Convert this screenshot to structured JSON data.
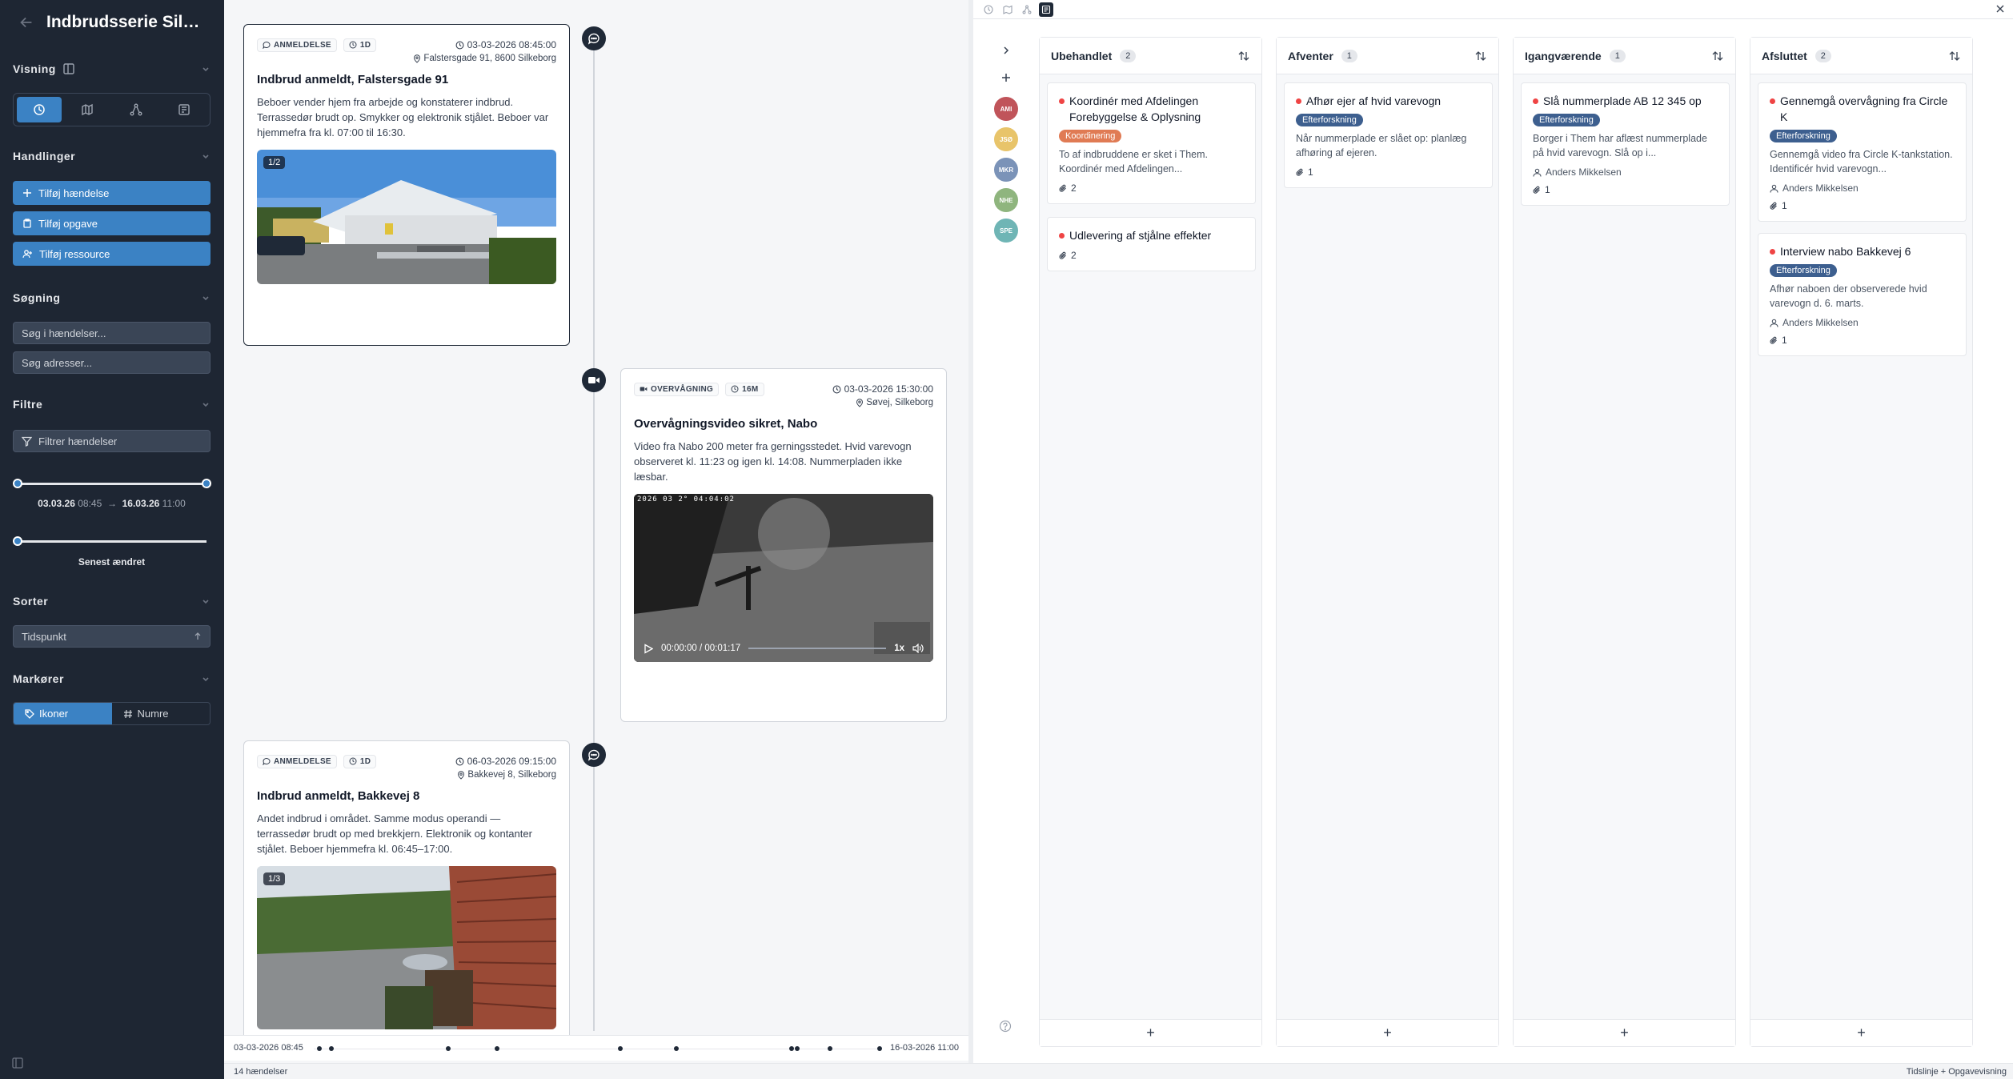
{
  "sidebar": {
    "title": "Indbrudsserie Silkeb...",
    "sections": {
      "visning": "Visning",
      "handlinger": "Handlinger",
      "sogning": "Søgning",
      "filtre": "Filtre",
      "sorter": "Sorter",
      "markorer": "Markører"
    },
    "actions": {
      "add_event": "Tilføj hændelse",
      "add_task": "Tilføj opgave",
      "add_resource": "Tilføj ressource"
    },
    "search": {
      "events_placeholder": "Søg i hændelser...",
      "address_placeholder": "Søg adresser..."
    },
    "filter": {
      "button": "Filtrer hændelser",
      "start_date": "03.03.26",
      "start_time": "08:45",
      "separator": "→",
      "end_date": "16.03.26",
      "end_time": "11:00",
      "recent_label": "Senest ændret"
    },
    "sort": {
      "value": "Tidspunkt"
    },
    "markers": {
      "icons": "Ikoner",
      "numbers": "Numre"
    }
  },
  "timeline": {
    "events": [
      {
        "tag": "ANMELDELSE",
        "duration": "1D",
        "datetime": "03-03-2026 08:45:00",
        "location": "Falstersgade 91, 8600 Silkeborg",
        "title": "Indbrud anmeldt, Falstersgade 91",
        "description": "Beboer vender hjem fra arbejde og konstaterer indbrud. Terrassedør brudt op. Smykker og elektronik stjålet. Beboer var hjemmefra fra kl. 07:00 til 16:30.",
        "media_counter": "1/2"
      },
      {
        "tag": "OVERVÅGNING",
        "duration": "16M",
        "datetime": "03-03-2026 15:30:00",
        "location": "Søvej, Silkeborg",
        "title": "Overvågningsvideo sikret, Nabo",
        "description": "Video fra Nabo 200 meter fra gerningsstedet. Hvid varevogn observeret kl. 11:23 og igen kl. 14:08. Nummerpladen ikke læsbar.",
        "video_stamp": "2026 03 2° 04:04:02",
        "video_time": "00:00:00 / 00:01:17",
        "video_speed": "1x"
      },
      {
        "tag": "ANMELDELSE",
        "duration": "1D",
        "datetime": "06-03-2026 09:15:00",
        "location": "Bakkevej 8, Silkeborg",
        "title": "Indbrud anmeldt, Bakkevej 8",
        "description": "Andet indbrud i området. Samme modus operandi — terrassedør brudt op med brekkjern. Elektronik og kontanter stjålet. Beboer hjemmefra kl. 06:45–17:00.",
        "media_counter": "1/3"
      }
    ],
    "axis_start": "03-03-2026 08:45",
    "axis_end": "16-03-2026 11:00"
  },
  "status": {
    "count": "14 hændelser",
    "view": "Tidslinje + Opgavevisning"
  },
  "kanban": {
    "avatars": [
      {
        "initials": "AMI",
        "color": "#c0545a"
      },
      {
        "initials": "JSØ",
        "color": "#e8c46a"
      },
      {
        "initials": "MKR",
        "color": "#7b93b8"
      },
      {
        "initials": "NHE",
        "color": "#8fb57e"
      },
      {
        "initials": "SPE",
        "color": "#6fb5b5"
      }
    ],
    "columns": [
      {
        "name": "Ubehandlet",
        "count": "2",
        "cards": [
          {
            "title": "Koordinér med Afdelingen Forebyggelse & Oplysning",
            "tag": "Koordinering",
            "tag_color": "#e07b54",
            "desc": "To af indbruddene er sket i Them. Koordinér med Afdelingen...",
            "assignee": "",
            "attachments": "2"
          },
          {
            "title": "Udlevering af stjålne effekter",
            "tag": "",
            "tag_color": "",
            "desc": "",
            "assignee": "",
            "attachments": "2"
          }
        ]
      },
      {
        "name": "Afventer",
        "count": "1",
        "cards": [
          {
            "title": "Afhør ejer af hvid varevogn",
            "tag": "Efterforskning",
            "tag_color": "#3d5f8f",
            "desc": "Når nummerplade er slået op: planlæg afhøring af ejeren.",
            "assignee": "",
            "attachments": "1"
          }
        ]
      },
      {
        "name": "Igangværende",
        "count": "1",
        "cards": [
          {
            "title": "Slå nummerplade AB 12 345 op",
            "tag": "Efterforskning",
            "tag_color": "#3d5f8f",
            "desc": "Borger i Them har aflæst nummerplade på hvid varevogn. Slå op i...",
            "assignee": "Anders Mikkelsen",
            "attachments": "1"
          }
        ]
      },
      {
        "name": "Afsluttet",
        "count": "2",
        "cards": [
          {
            "title": "Gennemgå overvågning fra Circle K",
            "tag": "Efterforskning",
            "tag_color": "#3d5f8f",
            "desc": "Gennemgå video fra Circle K-tankstation. Identificér hvid varevogn...",
            "assignee": "Anders Mikkelsen",
            "attachments": "1"
          },
          {
            "title": "Interview nabo Bakkevej 6",
            "tag": "Efterforskning",
            "tag_color": "#3d5f8f",
            "desc": "Afhør naboen der observerede hvid varevogn d. 6. marts.",
            "assignee": "Anders Mikkelsen",
            "attachments": "1"
          }
        ]
      }
    ],
    "add_symbol": "+"
  }
}
